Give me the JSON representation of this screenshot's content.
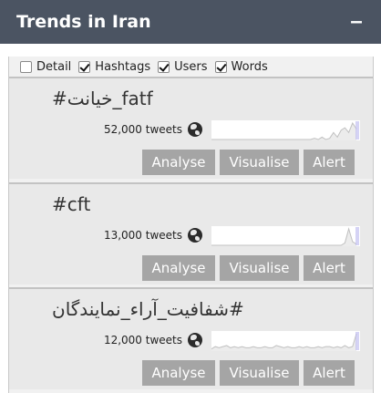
{
  "header": {
    "title": "Trends in Iran",
    "collapse_label": "–"
  },
  "filters": [
    {
      "label": "Detail",
      "checked": false
    },
    {
      "label": "Hashtags",
      "checked": true
    },
    {
      "label": "Users",
      "checked": true
    },
    {
      "label": "Words",
      "checked": true
    }
  ],
  "trends": [
    {
      "title": "#خیانت_fatf",
      "tweets": "52,000 tweets",
      "sparkline": [
        0,
        0,
        0,
        0,
        0,
        0,
        0,
        0,
        0,
        0,
        0,
        0,
        0,
        0,
        0,
        0,
        0,
        0,
        0,
        0,
        0,
        0,
        0,
        0,
        0,
        0,
        0,
        1,
        0,
        2,
        0,
        1,
        6,
        2,
        8,
        10,
        6,
        14,
        9
      ]
    },
    {
      "title": "#cft",
      "tweets": "13,000 tweets",
      "sparkline": [
        0,
        0,
        0,
        0,
        0,
        0,
        0,
        0,
        0,
        0,
        0,
        0,
        0,
        0,
        0,
        0,
        0,
        0,
        0,
        0,
        0,
        0,
        0,
        0,
        0,
        0,
        0,
        0,
        0,
        0,
        0,
        0,
        0,
        0,
        0,
        2,
        14,
        3,
        1
      ]
    },
    {
      "title": "شفافیت_آراء_نمایندگان#",
      "tweets": "12,000 tweets",
      "sparkline": [
        1,
        3,
        2,
        3,
        4,
        2,
        3,
        2,
        3,
        2,
        2,
        3,
        2,
        2,
        3,
        2,
        2,
        4,
        3,
        2,
        3,
        2,
        2,
        3,
        2,
        3,
        2,
        2,
        3,
        2,
        3,
        3,
        2,
        3,
        2,
        4,
        2,
        3,
        14
      ]
    }
  ],
  "buttons": {
    "analyse": "Analyse",
    "visualise": "Visualise",
    "alert": "Alert"
  },
  "colors": {
    "header_bg": "#4b5462",
    "button_bg": "#a5a5a5",
    "spark_line": "#c0c0c0",
    "spark_end": "#b9b6ee"
  }
}
